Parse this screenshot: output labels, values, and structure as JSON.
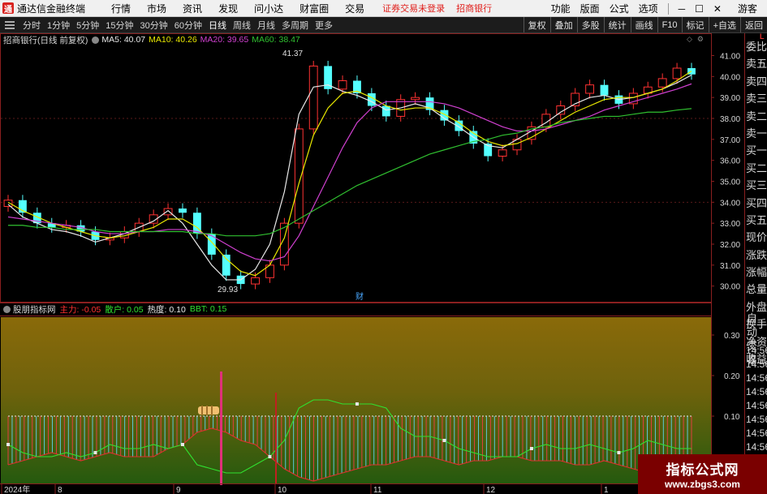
{
  "menubar": {
    "app_title": "通达信金融终端",
    "logo_glyph": "通",
    "menus": [
      "行情",
      "市场",
      "资讯",
      "发现",
      "问小达",
      "财富圈",
      "交易"
    ],
    "notice": "证券交易未登录",
    "stock_link": "招商银行",
    "right_menus": [
      "功能",
      "版面",
      "公式",
      "选项"
    ],
    "window_controls": [
      "─",
      "☐",
      "✕"
    ],
    "guest": "游客"
  },
  "toolbar": {
    "periods": [
      "分时",
      "1分钟",
      "5分钟",
      "15分钟",
      "30分钟",
      "60分钟",
      "日线",
      "周线",
      "月线",
      "多周期",
      "更多"
    ],
    "active_period": "日线",
    "right_buttons": [
      "复权",
      "叠加",
      "多股",
      "统计",
      "画线",
      "F10",
      "标记",
      "+自选",
      "返回"
    ]
  },
  "main_chart": {
    "title": "招商银行(日线 前复权)",
    "ma": [
      {
        "label": "MA5: 40.07",
        "color": "#e8e8e8"
      },
      {
        "label": "MA10: 40.26",
        "color": "#e8e800"
      },
      {
        "label": "MA20: 39.65",
        "color": "#d040d0"
      },
      {
        "label": "MA60: 38.47",
        "color": "#30c030"
      }
    ],
    "high_label": "41.37",
    "low_label": "29.93",
    "marker": "财",
    "price_axis": [
      "41.00",
      "40.00",
      "39.00",
      "38.00",
      "37.00",
      "36.00",
      "35.00",
      "34.00",
      "33.00",
      "32.00",
      "31.00",
      "30.00"
    ],
    "price_range": [
      29.6,
      41.6
    ]
  },
  "sub_chart": {
    "title": "股朋指标网",
    "items": [
      {
        "label": "主力: -0.05",
        "color": "#ff3030"
      },
      {
        "label": "散户: 0.05",
        "color": "#30e030"
      },
      {
        "label": "热度: 0.10",
        "color": "#e8e8e8"
      },
      {
        "label": "BBT: 0.15",
        "color": "#30e030"
      }
    ],
    "axis": [
      "0.30",
      "0.20",
      "0.10",
      "0.00"
    ],
    "value_range": [
      -0.06,
      0.34
    ]
  },
  "time_axis": [
    "2024年",
    "8",
    "9",
    "10",
    "11",
    "12",
    "1"
  ],
  "side_panel": {
    "top_tag": "L",
    "items": [
      "委比",
      "卖五",
      "卖四",
      "卖三",
      "卖二",
      "卖一",
      "买一",
      "买二",
      "买三",
      "买四",
      "买五",
      "现价",
      "涨跌",
      "涨幅",
      "总量",
      "外盘",
      "换手",
      "净资",
      "收益"
    ],
    "auto": "自动",
    "trade": "交易",
    "times": [
      "14:56",
      "14:56",
      "14:56",
      "14:56",
      "14:56",
      "14:56",
      "14:56",
      "14:56",
      "14:56",
      "14:56"
    ]
  },
  "watermark": {
    "line1": "指标公式网",
    "line2": "www.zbgs3.com"
  },
  "colors": {
    "up": "#ff3232",
    "down": "#54ffff",
    "ma5": "#e8e8e8",
    "ma10": "#e8e800",
    "ma20": "#d040d0",
    "ma60": "#30c030",
    "frame": "#8a1f1f"
  },
  "chart_data": {
    "type": "line",
    "title": "招商银行(日线 前复权)",
    "xlabel": "",
    "ylabel": "",
    "x_ticks": [
      "2024年",
      "8",
      "9",
      "10",
      "11",
      "12",
      "1"
    ],
    "ylim": [
      29.6,
      41.6
    ],
    "series": [
      {
        "name": "MA5",
        "values": [
          33.9,
          33.3,
          33.0,
          32.7,
          32.6,
          32.4,
          32.1,
          32.3,
          32.5,
          32.8,
          33.1,
          33.6,
          33.0,
          32.0,
          31.0,
          30.3,
          30.3,
          30.8,
          32.0,
          34.5,
          38.2,
          39.5,
          39.6,
          39.3,
          39.1,
          38.8,
          38.4,
          38.5,
          38.7,
          38.5,
          38.0,
          37.6,
          37.1,
          36.7,
          36.6,
          37.0,
          37.4,
          37.8,
          38.3,
          38.7,
          39.0,
          39.1,
          38.9,
          39.0,
          39.2,
          39.4,
          39.7,
          40.07
        ]
      },
      {
        "name": "MA10",
        "values": [
          34.0,
          33.6,
          33.3,
          33.0,
          32.8,
          32.6,
          32.4,
          32.3,
          32.4,
          32.6,
          32.8,
          33.2,
          33.2,
          32.8,
          32.1,
          31.3,
          30.7,
          30.5,
          31.0,
          32.3,
          34.9,
          37.2,
          38.5,
          39.2,
          39.3,
          39.0,
          38.6,
          38.4,
          38.5,
          38.5,
          38.2,
          37.8,
          37.3,
          36.9,
          36.7,
          36.8,
          37.1,
          37.5,
          37.9,
          38.3,
          38.6,
          38.9,
          39.0,
          39.0,
          39.2,
          39.4,
          39.8,
          40.26
        ]
      },
      {
        "name": "MA20",
        "values": [
          33.3,
          33.2,
          33.1,
          33.0,
          32.9,
          32.8,
          32.6,
          32.5,
          32.5,
          32.6,
          32.6,
          32.7,
          32.7,
          32.6,
          32.4,
          32.0,
          31.6,
          31.3,
          31.2,
          31.4,
          32.4,
          33.8,
          35.2,
          36.6,
          37.8,
          38.5,
          38.8,
          38.8,
          38.8,
          38.8,
          38.7,
          38.5,
          38.2,
          37.9,
          37.6,
          37.4,
          37.4,
          37.5,
          37.7,
          37.9,
          38.1,
          38.4,
          38.6,
          38.8,
          39.0,
          39.2,
          39.4,
          39.65
        ]
      },
      {
        "name": "MA60",
        "values": [
          32.9,
          32.9,
          32.8,
          32.8,
          32.7,
          32.7,
          32.7,
          32.6,
          32.6,
          32.6,
          32.6,
          32.6,
          32.6,
          32.5,
          32.5,
          32.4,
          32.4,
          32.4,
          32.5,
          32.8,
          33.2,
          33.6,
          34.0,
          34.4,
          34.8,
          35.1,
          35.4,
          35.7,
          36.0,
          36.3,
          36.5,
          36.7,
          36.9,
          37.0,
          37.2,
          37.3,
          37.5,
          37.6,
          37.8,
          37.9,
          38.0,
          38.1,
          38.1,
          38.2,
          38.3,
          38.3,
          38.4,
          38.47
        ]
      }
    ],
    "candles_close": [
      34.1,
      33.5,
      33.0,
      32.8,
      32.9,
      32.6,
      32.2,
      32.3,
      32.6,
      33.0,
      33.4,
      33.7,
      33.5,
      32.5,
      31.5,
      30.5,
      30.1,
      30.4,
      31.0,
      33.0,
      37.5,
      40.5,
      39.4,
      39.8,
      39.2,
      38.6,
      38.1,
      38.9,
      39.0,
      38.4,
      37.9,
      37.4,
      36.8,
      36.2,
      36.5,
      37.0,
      37.6,
      38.2,
      38.6,
      39.2,
      39.6,
      39.1,
      38.7,
      39.2,
      39.5,
      39.9,
      40.4,
      40.1
    ],
    "sub_series": [
      {
        "name": "热度",
        "values": [
          0.1,
          0.1,
          0.1,
          0.1,
          0.1,
          0.1,
          0.1,
          0.1,
          0.1,
          0.1,
          0.1,
          0.1,
          0.1,
          0.1,
          0.1,
          0.1,
          0.1,
          0.1,
          0.1,
          0.1,
          0.1,
          0.1,
          0.1,
          0.1,
          0.1,
          0.1,
          0.1,
          0.1,
          0.1,
          0.1,
          0.1,
          0.1,
          0.1,
          0.1,
          0.1,
          0.1,
          0.1,
          0.1,
          0.1,
          0.1,
          0.1,
          0.1,
          0.1,
          0.1,
          0.1,
          0.1,
          0.1,
          0.1
        ]
      },
      {
        "name": "BBT",
        "values": [
          0.03,
          0.01,
          0.0,
          0.0,
          0.01,
          0.0,
          0.01,
          0.03,
          0.02,
          0.02,
          0.03,
          0.02,
          0.03,
          -0.02,
          -0.03,
          -0.04,
          -0.04,
          -0.02,
          0.0,
          0.04,
          0.12,
          0.14,
          0.14,
          0.13,
          0.13,
          0.13,
          0.12,
          0.07,
          0.05,
          0.05,
          0.04,
          0.02,
          0.01,
          0.0,
          0.0,
          0.0,
          0.02,
          0.03,
          0.02,
          0.02,
          0.03,
          0.02,
          0.01,
          0.02,
          0.04,
          0.03,
          0.02,
          0.02
        ]
      },
      {
        "name": "主力",
        "values": [
          -0.02,
          -0.01,
          0.0,
          0.01,
          0.0,
          -0.01,
          0.0,
          0.01,
          0.0,
          0.0,
          0.0,
          0.02,
          0.03,
          0.06,
          0.07,
          0.06,
          0.04,
          0.03,
          0.0,
          -0.03,
          -0.05,
          -0.06,
          -0.05,
          -0.04,
          -0.03,
          -0.02,
          -0.02,
          -0.01,
          0.0,
          0.0,
          -0.01,
          -0.02,
          -0.01,
          -0.01,
          0.0,
          0.0,
          -0.01,
          -0.01,
          -0.01,
          -0.02,
          -0.02,
          -0.01,
          -0.02,
          -0.03,
          -0.04,
          -0.03,
          -0.05,
          -0.05
        ]
      }
    ],
    "sub_ylim": [
      -0.06,
      0.34
    ]
  }
}
